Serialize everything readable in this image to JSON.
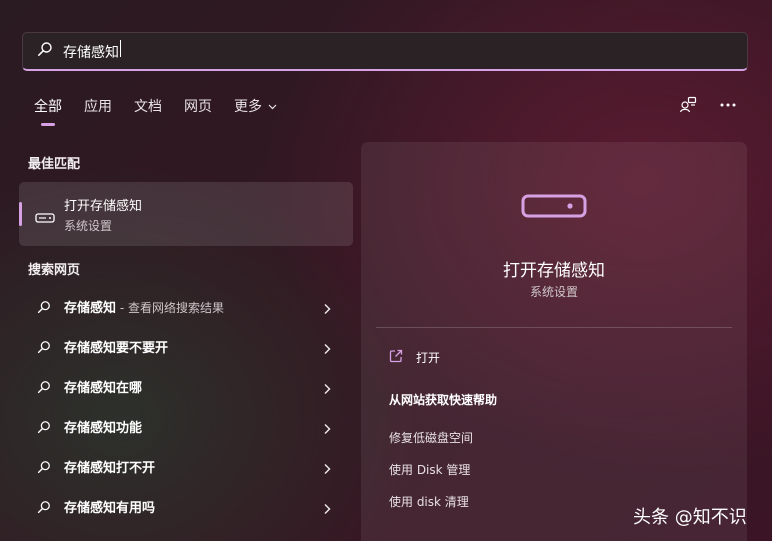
{
  "search": {
    "value": "存储感知"
  },
  "tabs": [
    {
      "label": "全部",
      "active": true
    },
    {
      "label": "应用"
    },
    {
      "label": "文档"
    },
    {
      "label": "网页"
    },
    {
      "label": "更多"
    }
  ],
  "best_match": {
    "section_title": "最佳匹配",
    "title": "打开存储感知",
    "subtitle": "系统设置"
  },
  "web": {
    "section_title": "搜索网页",
    "items": [
      {
        "label": "存储感知",
        "hint": " - 查看网络搜索结果"
      },
      {
        "label": "存储感知要不要开",
        "hint": ""
      },
      {
        "label": "存储感知在哪",
        "hint": ""
      },
      {
        "label": "存储感知功能",
        "hint": ""
      },
      {
        "label": "存储感知打不开",
        "hint": ""
      },
      {
        "label": "存储感知有用吗",
        "hint": ""
      }
    ]
  },
  "preview": {
    "title": "打开存储感知",
    "subtitle": "系统设置",
    "open_label": "打开",
    "help_title": "从网站获取快速帮助",
    "links": [
      "修复低磁盘空间",
      "使用 Disk 管理",
      "使用 disk 清理"
    ]
  },
  "watermark": "头条 @知不识",
  "colors": {
    "accent": "#d7a2e4"
  },
  "icons": [
    "search-icon",
    "drive-icon",
    "chevron-right-icon",
    "chevron-down-icon",
    "external-link-icon",
    "user-switch-icon",
    "more-icon"
  ]
}
